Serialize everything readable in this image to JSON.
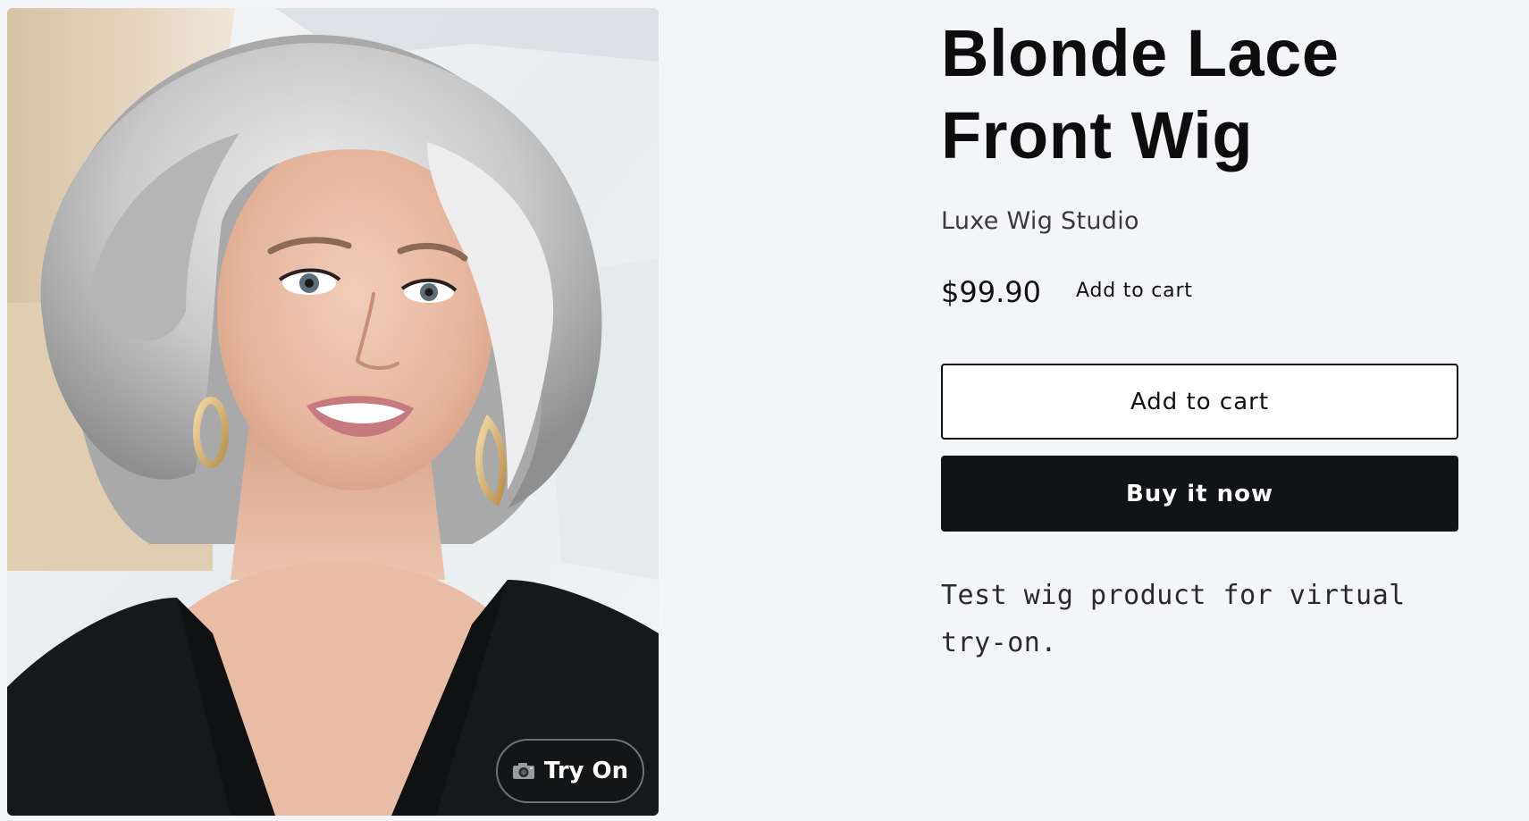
{
  "product": {
    "title": "Blonde Lace Front Wig",
    "vendor": "Luxe Wig Studio",
    "price": "$99.90",
    "price_add_to_cart_label": "Add to cart",
    "description": "Test wig product for virtual try-on."
  },
  "buttons": {
    "add_to_cart": "Add to cart",
    "buy_now": "Buy it now",
    "try_on": "Try On"
  },
  "icons": {
    "try_on": "camera-icon"
  },
  "colors": {
    "page_background": "#f4f5f9",
    "buy_button": "#111316",
    "try_on_button": "#141516"
  }
}
